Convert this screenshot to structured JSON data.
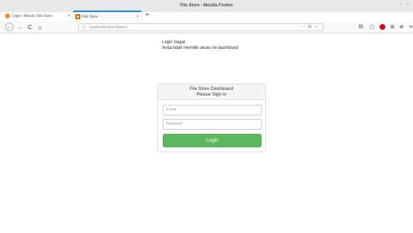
{
  "window": {
    "title": "File Store - Mozilla Firefox",
    "controls": [
      "–",
      "×"
    ]
  },
  "tabs": [
    {
      "label": "Login / Masuk | File Store",
      "close": "×",
      "active": false
    },
    {
      "label": "File Store",
      "close": "×",
      "active": true
    }
  ],
  "new_tab_label": "+",
  "navbar": {
    "back_icon": "←",
    "forward_icon": "→",
    "reload_icon": "C",
    "home_icon": "⌂",
    "url": "localhost/online-filestore",
    "url_more": "···",
    "pocket_icon": "◘",
    "bookmark_icon": "☆",
    "library_icon": "lll\\",
    "sidebar_icon": "▢",
    "ext_icon": "⊞",
    "account_icon": "⊕",
    "menu_icon": "≡"
  },
  "page": {
    "alert_title": "Login Gagal",
    "alert_message": "Anda tidak memiliki akses ke dashboard",
    "panel_title_1": "File Store Dashboard",
    "panel_title_2": "Please Sign In",
    "email_placeholder": "E-mail",
    "password_placeholder": "Password",
    "login_label": "Login"
  },
  "colors": {
    "login_button": "#5cb85c",
    "active_tab_accent": "#0a84ff",
    "ublock": "#d70022"
  }
}
